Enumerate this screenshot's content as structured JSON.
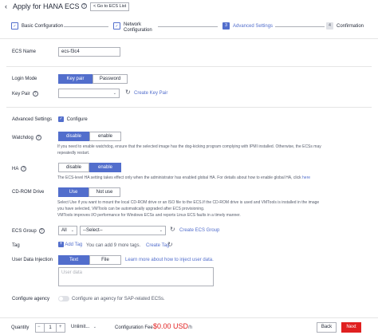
{
  "header": {
    "back_icon": "chevron-left-icon",
    "title": "Apply for HANA ECS",
    "goto_label": "< Go to ECS List"
  },
  "steps": [
    {
      "label": "Basic Configuration",
      "state": "done"
    },
    {
      "label_line1": "Network",
      "label_line2": "Configuration",
      "state": "done"
    },
    {
      "num": "3",
      "label": "Advanced Settings",
      "state": "active"
    },
    {
      "num": "4",
      "label": "Confirmation",
      "state": "pending"
    }
  ],
  "ecs_name": {
    "label": "ECS Name",
    "value": "ecs-f3c4"
  },
  "login_mode": {
    "label": "Login Mode",
    "options": [
      "Key pair",
      "Password"
    ],
    "selected": "Key pair"
  },
  "key_pair": {
    "label": "Key Pair",
    "value": "",
    "create_link": "Create Key Pair"
  },
  "advanced_settings": {
    "label": "Advanced Settings",
    "checkbox_label": "Configure",
    "checked": true
  },
  "watchdog": {
    "label": "Watchdog",
    "options": [
      "disable",
      "enable"
    ],
    "selected": "disable",
    "desc_line1": "If you need to enable watchdog, ensure that the selected image has the dog-kicking program complying with IPMI installed. Otherwise, the ECSs may",
    "desc_line2": "repeatedly restart."
  },
  "ha": {
    "label": "HA",
    "options": [
      "disable",
      "enable"
    ],
    "selected": "enable",
    "desc": "The ECS-level HA setting takes effect only when the administrator has enabled global HA. For details about how to enable global HA, click",
    "desc_link": "here"
  },
  "cdrom": {
    "label": "CD-ROM Drive",
    "options": [
      "Use",
      "Not use"
    ],
    "selected": "Use",
    "desc_line1": "Select Use if you want to mount the local CD-ROM drive or an ISO file to the ECS.If the CD-ROM drive is used and VMTools is installed in the image",
    "desc_line2": "you have selected, VMTools can be automatically upgraded after ECS provisioning.",
    "desc_line3": "VMTools improves I/O performance for Windows ECSs and reports Linux ECS faults in a timely manner."
  },
  "ecs_group": {
    "label": "ECS Group",
    "select1": "All",
    "select2": "--Select--",
    "create_link": "Create ECS Group"
  },
  "tag": {
    "label": "Tag",
    "add_label": "Add Tag",
    "hint": "You can add 9 more tags.",
    "create_link": "Create Tag"
  },
  "user_data": {
    "label": "User Data Injection",
    "options": [
      "Text",
      "File"
    ],
    "selected": "Text",
    "learn_link": "Learn more about how to inject user data.",
    "placeholder": "User data"
  },
  "configure_agency": {
    "label": "Configure agency",
    "text": "Configure an agency for SAP-related ECSs."
  },
  "footer": {
    "quantity_label": "Quantity",
    "quantity_value": "1",
    "minus": "−",
    "plus": "+",
    "unlimited": "Unlimit...",
    "fee_label": "Configuration Fee",
    "fee_value": "$0.00 USD",
    "fee_unit": "/h",
    "back_label": "Back",
    "next_label": "Next"
  },
  "colors": {
    "accent": "#526ecc",
    "fee": "#e02020",
    "next": "#e02020"
  }
}
